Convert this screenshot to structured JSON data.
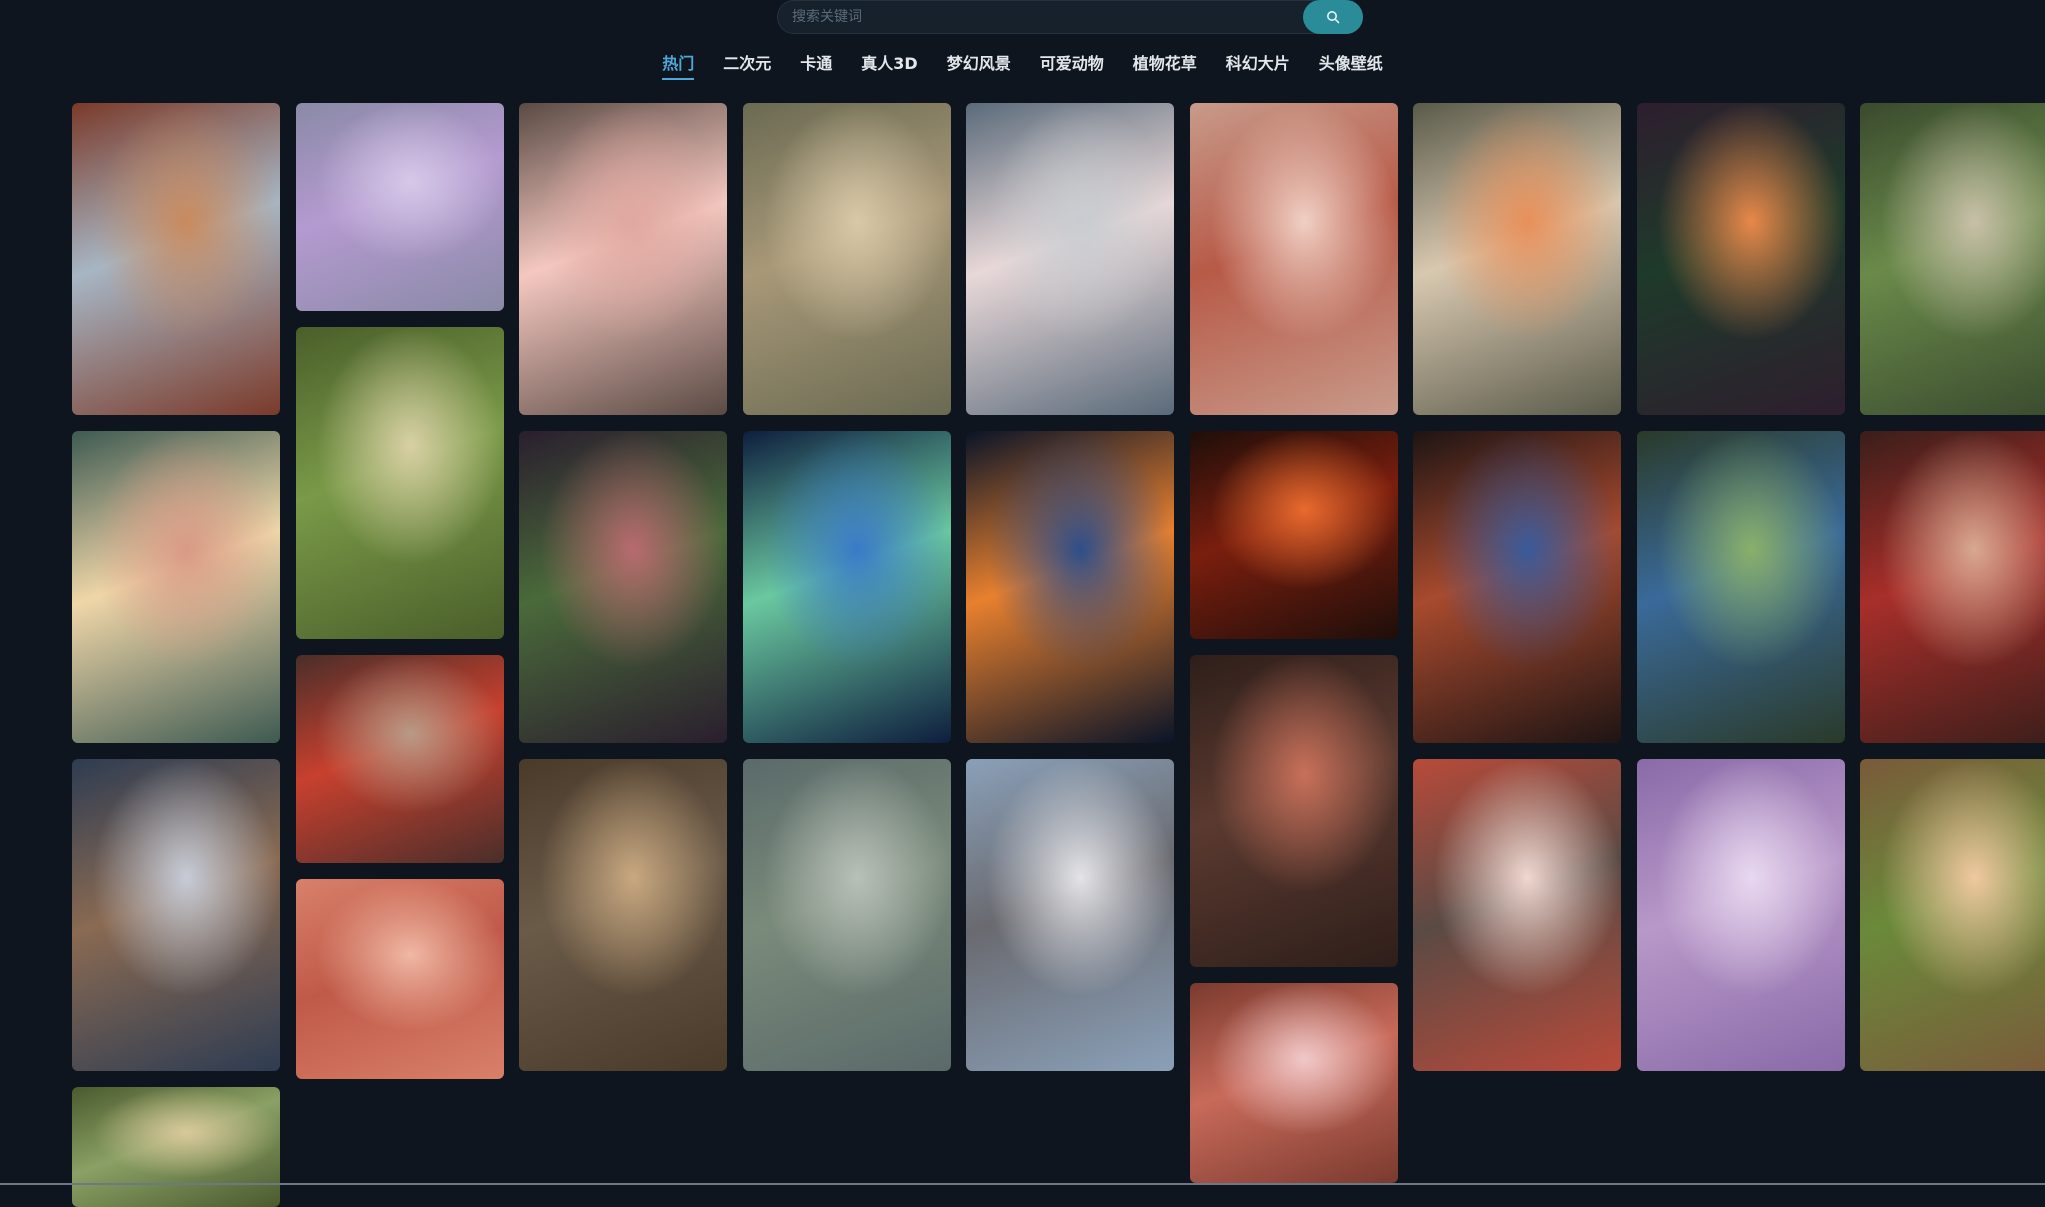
{
  "search": {
    "placeholder": "搜索关键词",
    "value": "",
    "button_icon": "search-icon"
  },
  "nav": {
    "items": [
      {
        "label": "热门",
        "active": true
      },
      {
        "label": "二次元",
        "active": false
      },
      {
        "label": "卡通",
        "active": false
      },
      {
        "label": "真人3D",
        "active": false
      },
      {
        "label": "梦幻风景",
        "active": false
      },
      {
        "label": "可爱动物",
        "active": false
      },
      {
        "label": "植物花草",
        "active": false
      },
      {
        "label": "科幻大片",
        "active": false
      },
      {
        "label": "头像壁纸",
        "active": false
      }
    ]
  },
  "colors": {
    "background": "#0e151e",
    "accent": "#4ea7d8",
    "search_button": "#2a8c98"
  },
  "gallery": {
    "columns": [
      [
        {
          "subject": "hanfu-girl-with-red-lanterns",
          "palette": [
            "#7a3a2a",
            "#c98a5e",
            "#a7b6c4"
          ]
        },
        {
          "subject": "lanterns-and-peony-flowers",
          "palette": [
            "#3e5a52",
            "#d99a86",
            "#efd6a8"
          ]
        },
        {
          "subject": "girl-with-hair-ornaments-blue-robe",
          "palette": [
            "#2e3c52",
            "#c6ccd8",
            "#8a6a52"
          ]
        },
        {
          "subject": "elf-girl-with-flower-crown",
          "palette": [
            "#4a5a2e",
            "#d8c89a",
            "#8aa064"
          ]
        }
      ],
      [
        {
          "subject": "girl-with-purple-flowers",
          "palette": [
            "#8a8aa6",
            "#d6c8e8",
            "#b49ad0"
          ]
        },
        {
          "subject": "elf-girl-sitting-in-forest",
          "palette": [
            "#4a5e2a",
            "#d8d0a4",
            "#7a9a48"
          ]
        },
        {
          "subject": "girl-with-veil-and-lanterns",
          "palette": [
            "#4a2e2a",
            "#b89a86",
            "#c8402e"
          ]
        },
        {
          "subject": "girl-reading-under-cherry-blossoms",
          "palette": [
            "#d8806a",
            "#f0b8a4",
            "#c05a48"
          ]
        }
      ],
      [
        {
          "subject": "girl-in-pink-dress",
          "palette": [
            "#5a4a44",
            "#e0a8a0",
            "#f4c8c0"
          ]
        },
        {
          "subject": "waterfall-fantasy-landscape",
          "palette": [
            "#2a1e2e",
            "#b86a6e",
            "#4a6a3a"
          ]
        },
        {
          "subject": "girl-with-golden-headdress",
          "palette": [
            "#4a3a2a",
            "#c8a880",
            "#6a5a48"
          ]
        }
      ],
      [
        {
          "subject": "girl-by-river-with-bird",
          "palette": [
            "#6a6a52",
            "#d8c8a8",
            "#a89878"
          ]
        },
        {
          "subject": "cartoon-explorer-with-blue-hat",
          "palette": [
            "#0e1e3e",
            "#3a7ac8",
            "#6ac8a0"
          ]
        },
        {
          "subject": "girl-holding-lotus-by-lake",
          "palette": [
            "#5a6a6a",
            "#b8c0b8",
            "#7a8a7a"
          ]
        }
      ],
      [
        {
          "subject": "girl-sitting-in-boat",
          "palette": [
            "#5a6a7a",
            "#c8ccd0",
            "#e8d8d8"
          ]
        },
        {
          "subject": "cartoon-boy-with-lantern-at-night",
          "palette": [
            "#0a1428",
            "#2e4e8a",
            "#e8802e"
          ]
        },
        {
          "subject": "girl-in-white-hanfu-with-pavilion",
          "palette": [
            "#8aa0b8",
            "#e4e4e8",
            "#6a6a70"
          ]
        }
      ],
      [
        {
          "subject": "girl-with-cherry-blossoms",
          "palette": [
            "#c89a8a",
            "#f0d0c4",
            "#b85a48"
          ]
        },
        {
          "subject": "fire-pirate-boy",
          "palette": [
            "#1e0e0a",
            "#e86a2e",
            "#7a1e0e"
          ]
        },
        {
          "subject": "girl-in-armor",
          "palette": [
            "#2e1e1a",
            "#c8705a",
            "#5a3a30"
          ]
        },
        {
          "subject": "pink-haired-girl",
          "palette": [
            "#7a3a2e",
            "#f0c8c8",
            "#c86a5a"
          ]
        }
      ],
      [
        {
          "subject": "girl-with-orange-flowers",
          "palette": [
            "#5a5a4a",
            "#e8905a",
            "#d8c8b0"
          ]
        },
        {
          "subject": "little-wizard-in-library",
          "palette": [
            "#1e1414",
            "#3a5a9a",
            "#a84a2e"
          ]
        },
        {
          "subject": "girl-in-red-hanfu-by-railing",
          "palette": [
            "#b84a3a",
            "#f0d8d0",
            "#5a4a44"
          ]
        }
      ],
      [
        {
          "subject": "fantasy-pagoda-mountain",
          "palette": [
            "#2e1e2e",
            "#e8884a",
            "#1e3a2a"
          ]
        },
        {
          "subject": "cartoon-boy-in-garden",
          "palette": [
            "#2a3a2a",
            "#8ab06a",
            "#3a6a9a"
          ]
        },
        {
          "subject": "girl-with-wisteria",
          "palette": [
            "#8a6aa8",
            "#e8d8f0",
            "#b898c8"
          ]
        }
      ],
      [
        {
          "subject": "girl-with-leaf-crown",
          "palette": [
            "#3a4a2e",
            "#c8c0a8",
            "#6a8a4a"
          ]
        },
        {
          "subject": "girl-with-red-headdress",
          "palette": [
            "#3a1e1a",
            "#d8a890",
            "#a82e2a"
          ]
        },
        {
          "subject": "girl-in-green-with-flowers",
          "palette": [
            "#7a5a3a",
            "#f0c8a0",
            "#6a8a3a"
          ]
        }
      ]
    ]
  }
}
